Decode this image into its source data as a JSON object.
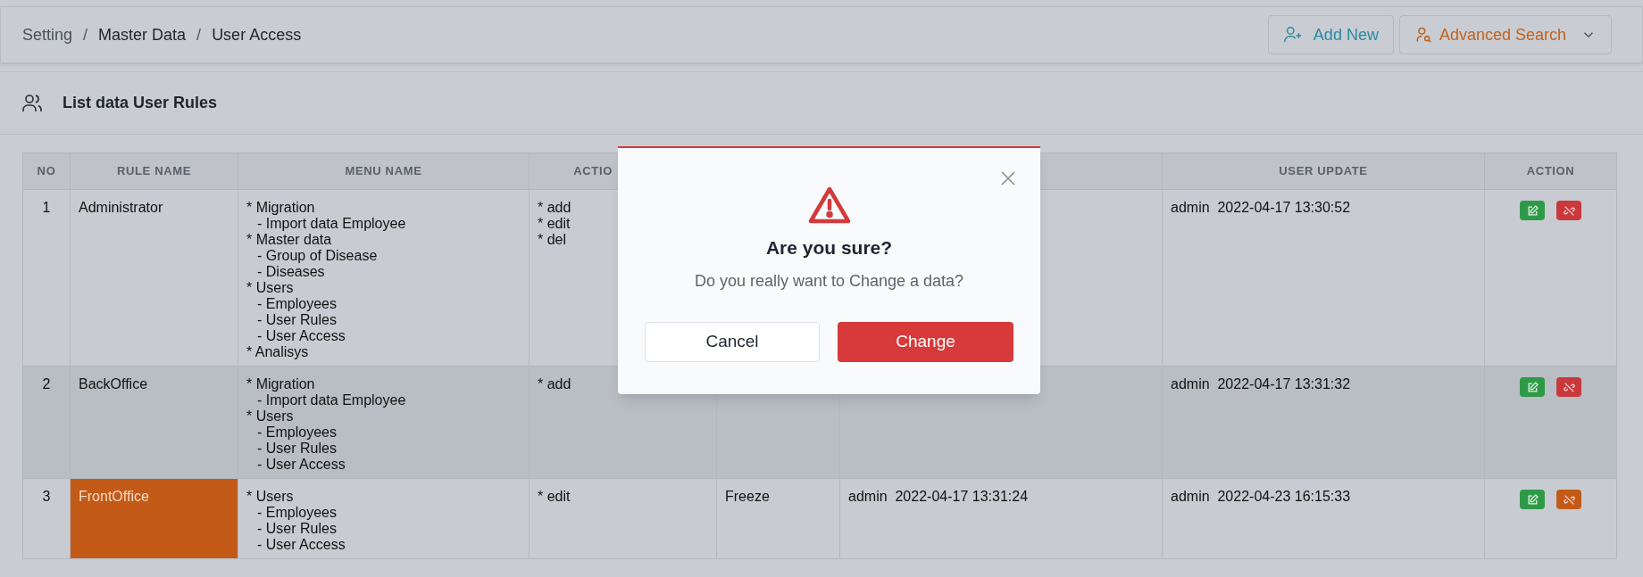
{
  "breadcrumb": [
    {
      "kind": "link",
      "text": "Setting"
    },
    {
      "kind": "separator",
      "text": "/"
    },
    {
      "kind": "link",
      "text": "Master Data"
    },
    {
      "kind": "separator",
      "text": "/"
    },
    {
      "kind": "link",
      "text": "User Access"
    }
  ],
  "buttons": {
    "add_new": "Add New",
    "advanced_search": "Advanced Search"
  },
  "card": {
    "title": "List data User Rules"
  },
  "table": {
    "columns": [
      "NO",
      "RULE NAME",
      "MENU NAME",
      "ACTIO",
      "",
      "",
      "USER UPDATE",
      "ACTION"
    ],
    "rows": [
      {
        "no": "1",
        "rule_name": "Administrator",
        "highlighted": false,
        "hovered": false,
        "menus": [
          {
            "label": "* Migration",
            "children": [
              {
                "label": "- Import data Employee"
              }
            ]
          },
          {
            "label": "* Master data",
            "children": [
              {
                "label": "- Group of Disease"
              },
              {
                "label": "- Diseases"
              }
            ]
          },
          {
            "label": "* Users",
            "children": [
              {
                "label": "- Employees"
              },
              {
                "label": "- User Rules"
              },
              {
                "label": "- User Access"
              }
            ]
          },
          {
            "label": "* Analisys"
          }
        ],
        "actions": [
          "* add",
          "* edit",
          "* del"
        ],
        "column_5": "",
        "column_6": "",
        "user_update": {
          "user": "admin",
          "time": "2022-04-17 13:30:52"
        },
        "color": "#c9383b"
      },
      {
        "no": "2",
        "rule_name": "BackOffice",
        "highlighted": false,
        "hovered": true,
        "menus": [
          {
            "label": "* Migration",
            "children": [
              {
                "label": "- Import data Employee"
              }
            ]
          },
          {
            "label": "* Users",
            "children": [
              {
                "label": "- Employees"
              },
              {
                "label": "- User Rules"
              },
              {
                "label": "- User Access"
              }
            ]
          }
        ],
        "actions": [
          "* add"
        ],
        "column_5": "",
        "column_6": "",
        "user_update": {
          "user": "admin",
          "time": "2022-04-17 13:31:32"
        },
        "color": "#c9383b"
      },
      {
        "no": "3",
        "rule_name": "FrontOffice",
        "highlighted": true,
        "hovered": false,
        "menus": [
          {
            "label": "* Users",
            "children": [
              {
                "label": "- Employees"
              },
              {
                "label": "- User Rules"
              },
              {
                "label": "- User Access"
              }
            ]
          }
        ],
        "actions": [
          "* edit"
        ],
        "column_5": "Freeze",
        "column_6": {
          "user": "admin",
          "time": "2022-04-17 13:31:24"
        },
        "user_update": {
          "user": "admin",
          "time": "2022-04-23 16:15:33"
        },
        "color": "#c45a17"
      }
    ]
  },
  "dialog": {
    "title": "Are you sure?",
    "message": "Do you really want to Change a data?",
    "cancel": "Cancel",
    "confirm": "Change"
  }
}
